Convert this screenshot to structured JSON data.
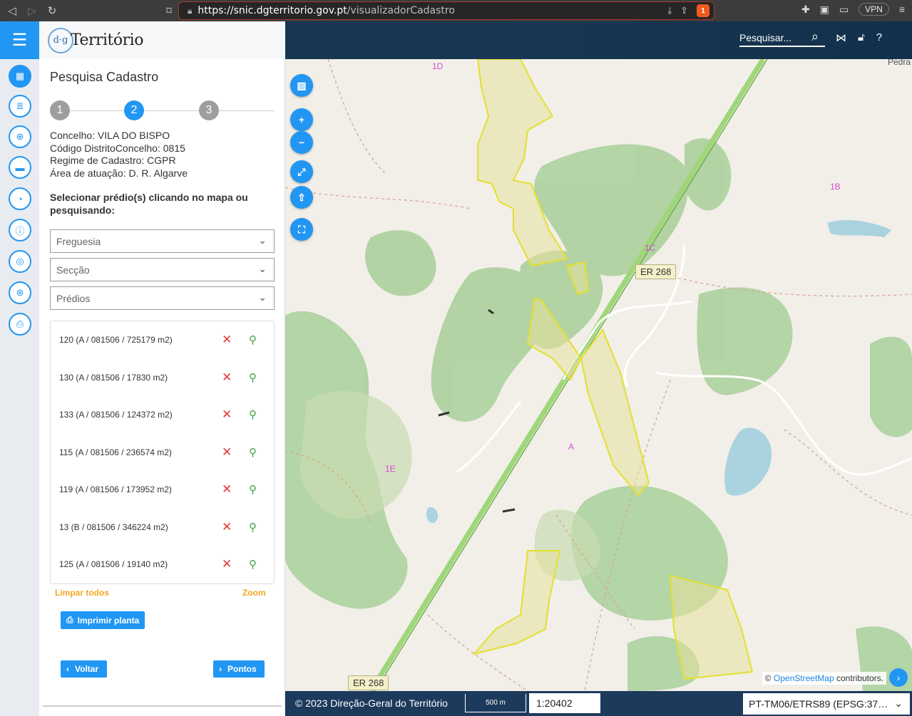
{
  "browser": {
    "url_host": "https://snic.dgterritorio.gov.pt",
    "url_path": "/visualizadorCadastro",
    "vpn_label": "VPN",
    "brave_badge": "1"
  },
  "header": {
    "logo_mark": "d·g",
    "logo_word": "Território",
    "search_placeholder": "Pesquisar..."
  },
  "panel": {
    "title": "Pesquisa Cadastro",
    "steps": [
      "1",
      "2",
      "3"
    ],
    "active_step": 2,
    "info": {
      "concelho": "Concelho: VILA DO BISPO",
      "codigo": "Código DistritoConcelho: 0815",
      "regime": "Regime de Cadastro: CGPR",
      "area": "Área de atuação: D. R. Algarve"
    },
    "instruction": "Selecionar prédio(s) clicando no mapa ou pesquisando:",
    "selects": {
      "freguesia": "Freguesia",
      "seccao": "Secção",
      "predios": "Prédios"
    },
    "parcels": [
      "120 (A / 081506 / 725179 m2)",
      "130 (A / 081506 / 17830 m2)",
      "133 (A / 081506 / 124372 m2)",
      "115 (A / 081506 / 236574 m2)",
      "119 (A / 081506 / 173952 m2)",
      "13 (B / 081506 / 346224 m2)",
      "125 (A / 081506 / 19140 m2)"
    ],
    "clear_all": "Limpar todos",
    "zoom": "Zoom",
    "print_button": "Imprimir planta",
    "back_button": "Voltar",
    "next_button": "Pontos"
  },
  "map": {
    "road_labels": [
      "ER 268",
      "ER 268"
    ],
    "area_labels": [
      "1D",
      "1B",
      "1C",
      "A",
      "1E"
    ],
    "place_label": "Pedra",
    "attribution_prefix": "©",
    "attribution_link": "OpenStreetMap",
    "attribution_suffix": "contributors."
  },
  "footer": {
    "copyright": "© 2023 Direção-Geral do Território",
    "scale_bar": "500 m",
    "scale_value": "1:20402",
    "projection": "PT-TM06/ETRS89 (EPSG:37…"
  },
  "colors": {
    "primary": "#2196f3",
    "header_bg": "#1b3553",
    "remove": "#e53935",
    "zoom": "#43a047",
    "link": "#f5a623",
    "parcel_outline": "#e3e02e"
  }
}
